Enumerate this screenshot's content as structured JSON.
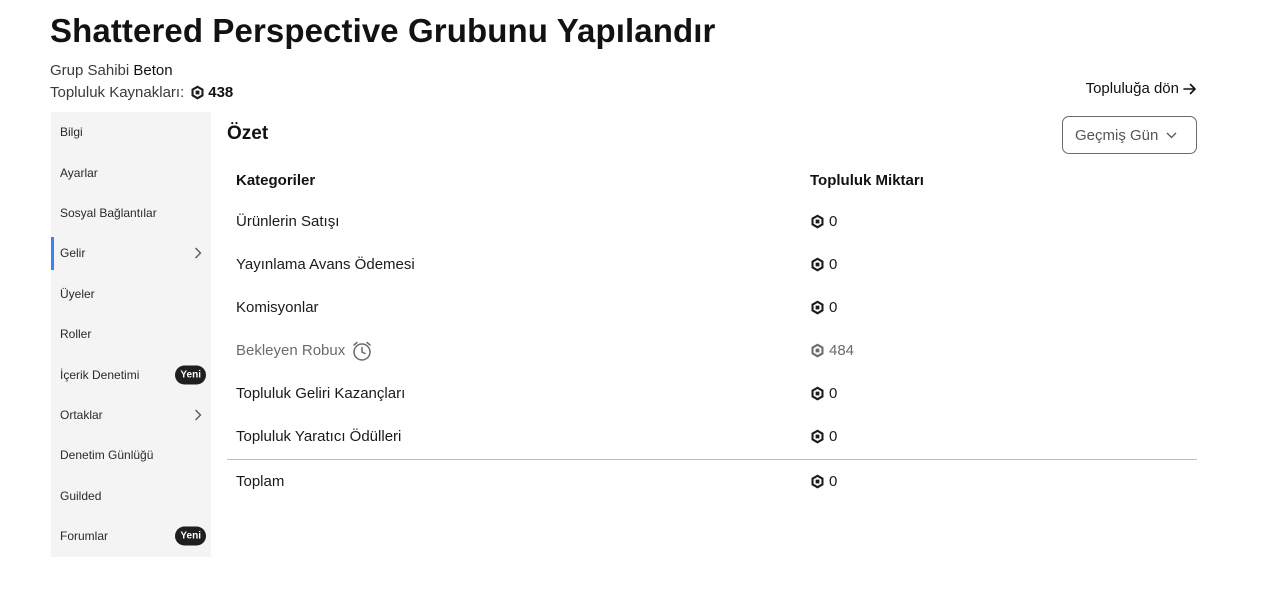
{
  "header": {
    "title": "Shattered Perspective Grubunu Yapılandır",
    "owner_label": "Grup Sahibi",
    "owner_name": "Beton",
    "funds_label": "Topluluk Kaynakları:",
    "funds_amount": "438",
    "back_link": "Topluluğa dön"
  },
  "sidebar": {
    "items": [
      {
        "label": "Bilgi"
      },
      {
        "label": "Ayarlar"
      },
      {
        "label": "Sosyal Bağlantılar"
      },
      {
        "label": "Gelir"
      },
      {
        "label": "Üyeler"
      },
      {
        "label": "Roller"
      },
      {
        "label": "İçerik Denetimi",
        "badge": "Yeni"
      },
      {
        "label": "Ortaklar"
      },
      {
        "label": "Denetim Günlüğü"
      },
      {
        "label": "Guilded"
      },
      {
        "label": "Forumlar",
        "badge": "Yeni"
      }
    ],
    "active_index": 3,
    "accent_color": "#3b82f6"
  },
  "summary": {
    "title": "Özet",
    "range_select": "Geçmiş Gün",
    "col_category": "Kategoriler",
    "col_amount": "Topluluk Miktarı",
    "rows": [
      {
        "category": "Ürünlerin Satışı",
        "amount": "0"
      },
      {
        "category": "Yayınlama Avans Ödemesi",
        "amount": "0"
      },
      {
        "category": "Komisyonlar",
        "amount": "0"
      },
      {
        "category": "Bekleyen Robux",
        "amount": "484",
        "icon": "clock-icon"
      },
      {
        "category": "Topluluk Geliri Kazançları",
        "amount": "0"
      },
      {
        "category": "Topluluk Yaratıcı Ödülleri",
        "amount": "0"
      }
    ],
    "total_label": "Toplam",
    "total_amount": "0"
  }
}
